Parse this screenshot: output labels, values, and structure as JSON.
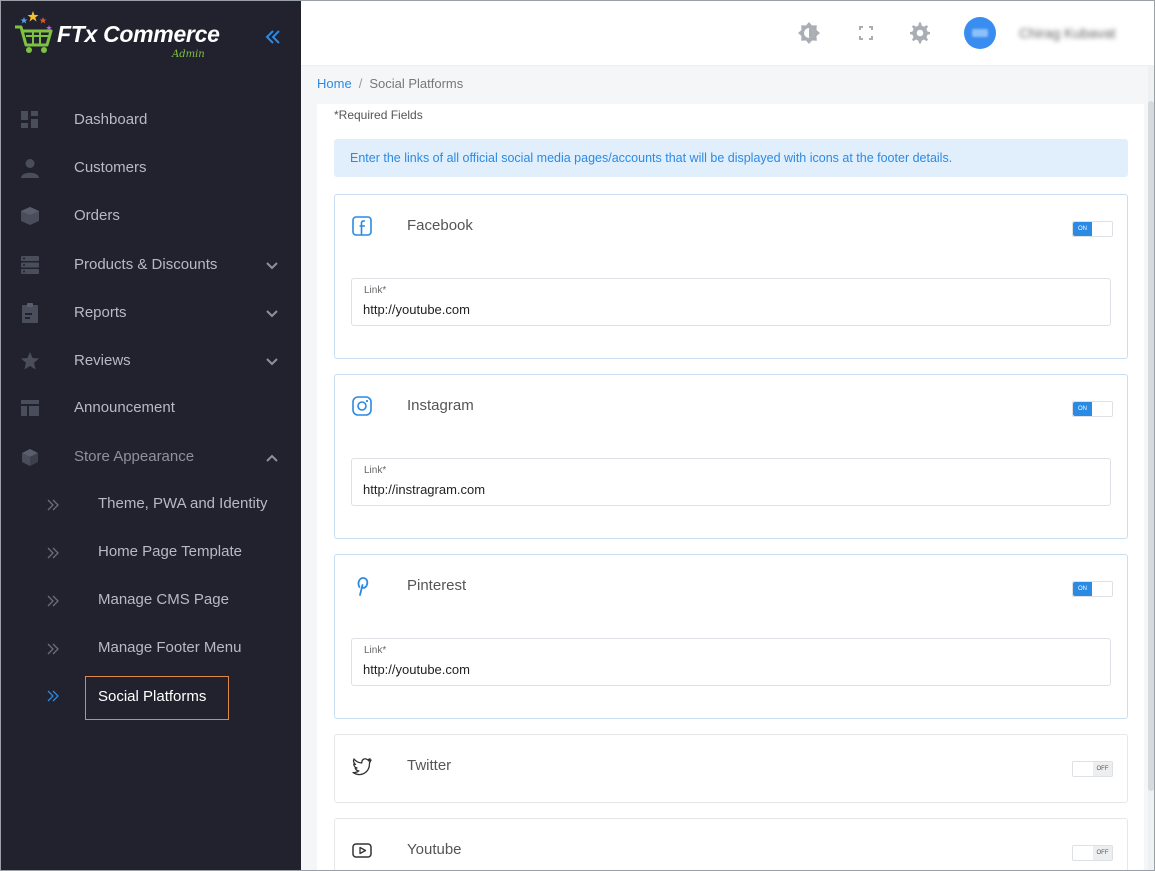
{
  "app": {
    "brand": "FTx Commerce",
    "brand_sub": "Admin"
  },
  "sidebar": {
    "items": [
      {
        "label": "Dashboard",
        "icon": "dashboard-icon"
      },
      {
        "label": "Customers",
        "icon": "user-icon"
      },
      {
        "label": "Orders",
        "icon": "box-icon"
      },
      {
        "label": "Products & Discounts",
        "icon": "server-icon"
      },
      {
        "label": "Reports",
        "icon": "clipboard-icon"
      },
      {
        "label": "Reviews",
        "icon": "star-icon"
      },
      {
        "label": "Announcement",
        "icon": "layout-icon"
      },
      {
        "label": "Store Appearance",
        "icon": "cube-icon"
      }
    ],
    "sub_items": [
      {
        "label": "Theme, PWA and Identity"
      },
      {
        "label": "Home Page Template"
      },
      {
        "label": "Manage CMS Page"
      },
      {
        "label": "Manage Footer Menu"
      },
      {
        "label": "Social Platforms"
      }
    ]
  },
  "topbar": {
    "username": "Chirag Kubavat"
  },
  "breadcrumb": {
    "home": "Home",
    "separator": "/",
    "current": "Social Platforms"
  },
  "main": {
    "required_note": "*Required Fields",
    "info_text": "Enter the links of all official social media pages/accounts that will be displayed with icons at the footer details.",
    "platforms": [
      {
        "name": "Facebook",
        "icon": "facebook-icon",
        "enabled": true,
        "toggle_label": "ON",
        "link_label": "Link*",
        "link_value": "http://youtube.com"
      },
      {
        "name": "Instagram",
        "icon": "instagram-icon",
        "enabled": true,
        "toggle_label": "ON",
        "link_label": "Link*",
        "link_value": "http://instragram.com"
      },
      {
        "name": "Pinterest",
        "icon": "pinterest-icon",
        "enabled": true,
        "toggle_label": "ON",
        "link_label": "Link*",
        "link_value": "http://youtube.com"
      },
      {
        "name": "Twitter",
        "icon": "twitter-icon",
        "enabled": false,
        "toggle_label": "OFF"
      },
      {
        "name": "Youtube",
        "icon": "youtube-icon",
        "enabled": false,
        "toggle_label": "OFF"
      }
    ]
  },
  "colors": {
    "sidebar_bg": "#22222e",
    "accent": "#2b8ae3",
    "active_outline": "#e0874a",
    "brand_green": "#7ec242"
  }
}
